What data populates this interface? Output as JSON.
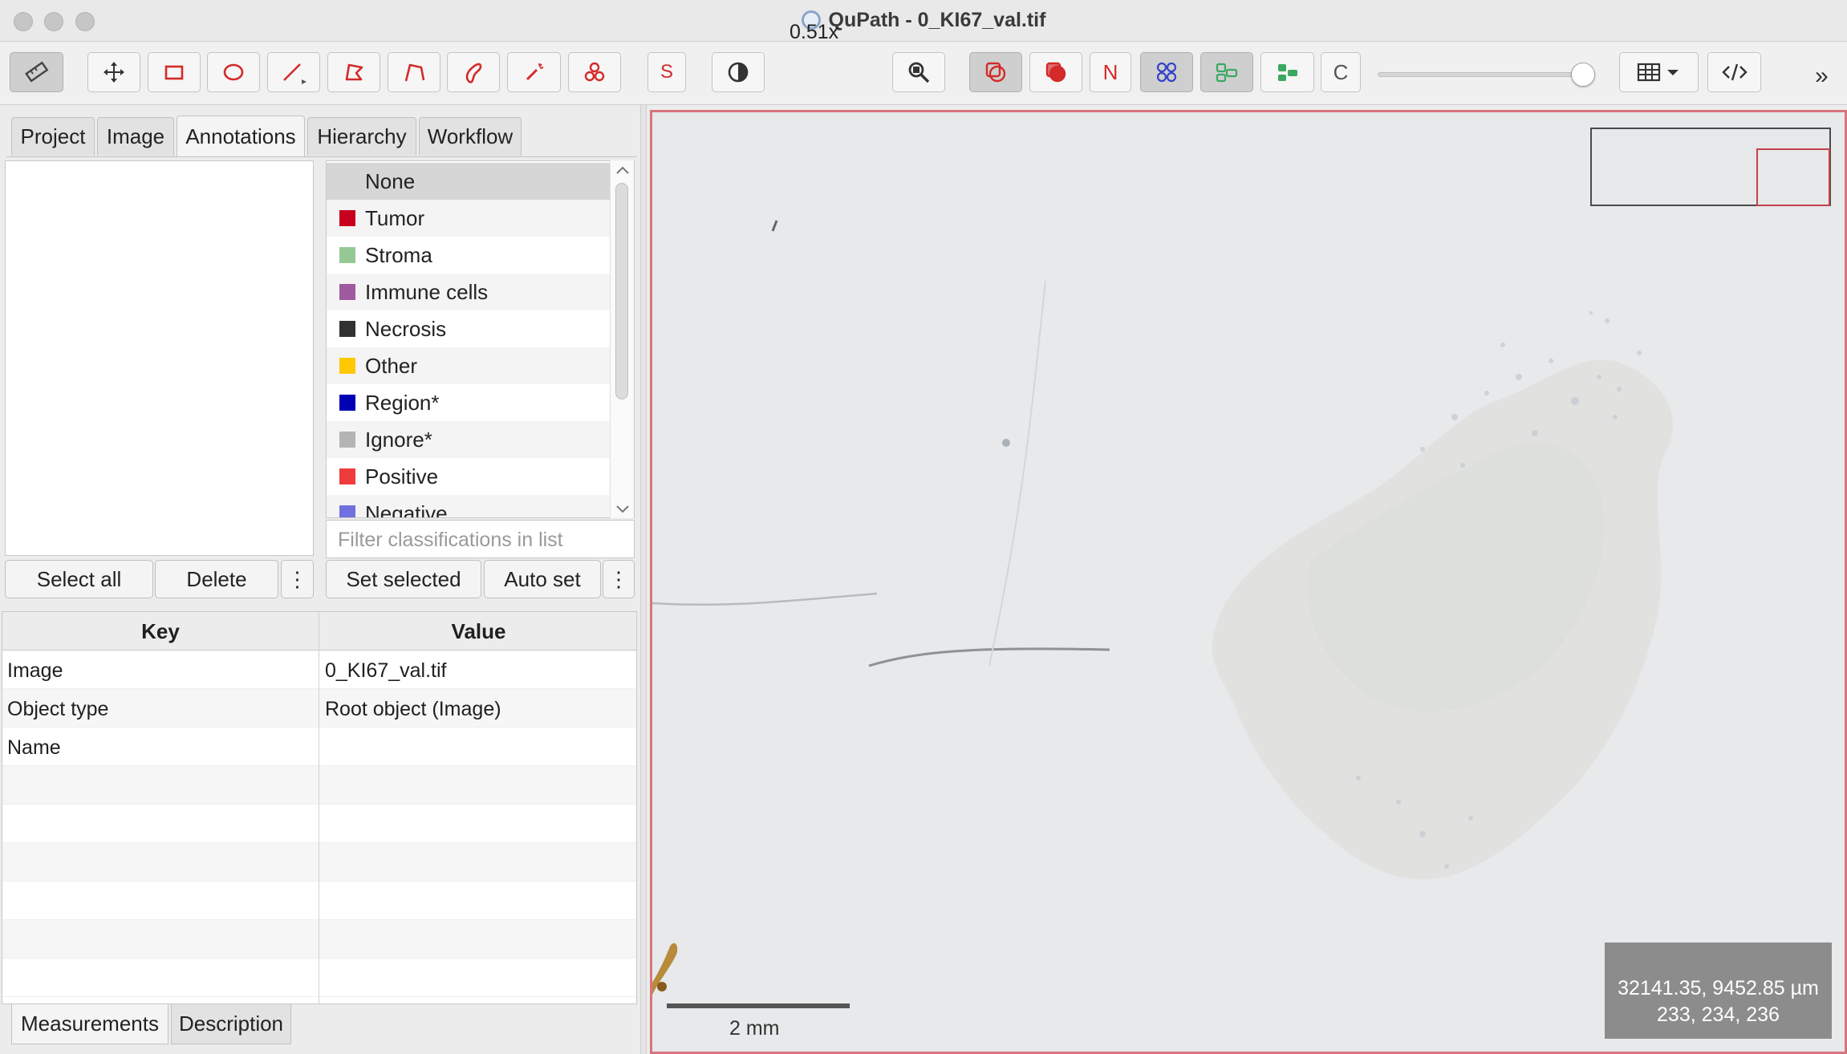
{
  "window": {
    "title": "QuPath - 0_KI67_val.tif"
  },
  "toolbar": {
    "zoom": "0.51x",
    "s_label": "S",
    "n_label": "N",
    "c_label": "C",
    "icons": [
      "ruler-icon",
      "move-icon",
      "rectangle-icon",
      "ellipse-icon",
      "line-icon",
      "polygon-icon",
      "polyline-icon",
      "brush-icon",
      "wand-icon",
      "points-icon",
      "selection-mode-icon",
      "brightness-contrast-icon",
      "zoom-to-fit-icon",
      "show-annotations-icon",
      "fill-annotations-icon",
      "show-names-icon",
      "show-tma-grid-icon",
      "show-detections-icon",
      "fill-detections-icon",
      "show-pixel-classification-icon",
      "measurement-table-icon",
      "script-editor-icon"
    ]
  },
  "left_tabs": [
    "Project",
    "Image",
    "Annotations",
    "Hierarchy",
    "Workflow"
  ],
  "classes": [
    {
      "name": "None",
      "color": ""
    },
    {
      "name": "Tumor",
      "color": "#c8001e"
    },
    {
      "name": "Stroma",
      "color": "#96c896"
    },
    {
      "name": "Immune cells",
      "color": "#a05aa0"
    },
    {
      "name": "Necrosis",
      "color": "#323232"
    },
    {
      "name": "Other",
      "color": "#ffc800"
    },
    {
      "name": "Region*",
      "color": "#0000b4"
    },
    {
      "name": "Ignore*",
      "color": "#b4b4b4"
    },
    {
      "name": "Positive",
      "color": "#ef3b3b"
    },
    {
      "name": "Negative",
      "color": "#7070e0"
    }
  ],
  "filter_placeholder": "Filter classifications in list",
  "buttons": {
    "select_all": "Select all",
    "delete": "Delete",
    "set_selected": "Set selected",
    "auto_set": "Auto set",
    "more": "⋮"
  },
  "table": {
    "headers": {
      "key": "Key",
      "value": "Value"
    },
    "rows": [
      {
        "key": "Image",
        "value": "0_KI67_val.tif"
      },
      {
        "key": "Object type",
        "value": "Root object (Image)"
      },
      {
        "key": "Name",
        "value": ""
      }
    ]
  },
  "bottom_tabs": [
    "Measurements",
    "Description"
  ],
  "viewer": {
    "scale_label": "2 mm",
    "cursor_position": "32141.35, 9452.85 µm",
    "pixel_value": "233, 234, 236",
    "border_color": "#d8747c"
  }
}
